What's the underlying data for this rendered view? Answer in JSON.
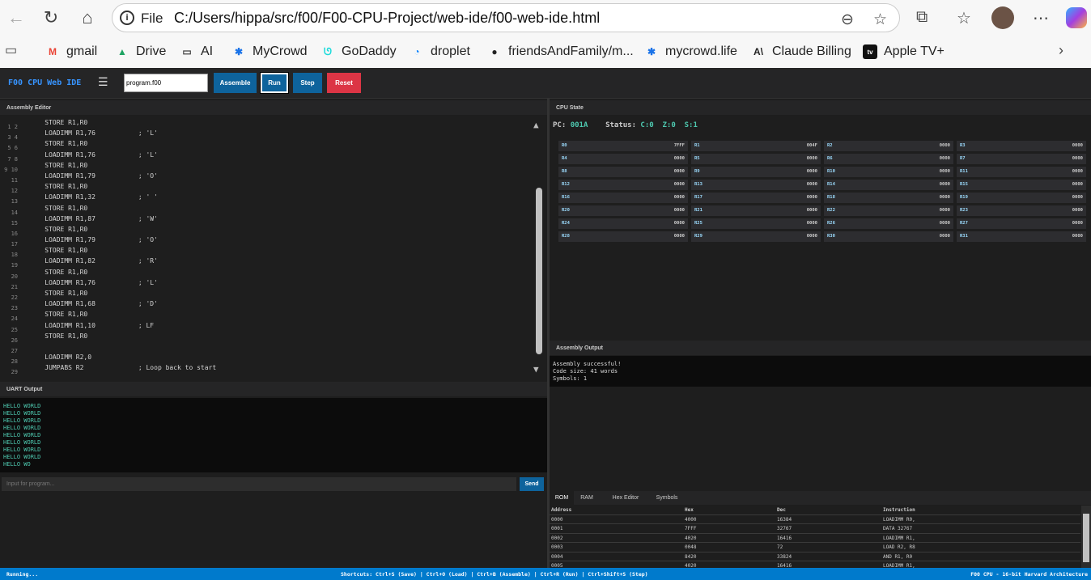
{
  "browser": {
    "file_label": "File",
    "url": "C:/Users/hippa/src/f00/F00-CPU-Project/web-ide/f00-web-ide.html",
    "bookmarks": [
      {
        "label": "gmail",
        "icon": "gmail-icon",
        "glyph": "M",
        "color": "#ea4335"
      },
      {
        "label": "Drive",
        "icon": "drive-icon",
        "glyph": "▲",
        "color": "#1fa463"
      },
      {
        "label": "AI",
        "icon": "folder-icon",
        "glyph": "▭",
        "color": "#444444"
      },
      {
        "label": "MyCrowd",
        "icon": "mycrowd-icon",
        "glyph": "✱",
        "color": "#1a73e8"
      },
      {
        "label": "GoDaddy",
        "icon": "godaddy-icon",
        "glyph": "ᘎ",
        "color": "#1bdbdb"
      },
      {
        "label": "droplet",
        "icon": "digitalocean-icon",
        "glyph": "◔",
        "color": "#0080ff"
      },
      {
        "label": "friendsAndFamily/m...",
        "icon": "github-icon",
        "glyph": "●",
        "color": "#222222"
      },
      {
        "label": "mycrowd.life",
        "icon": "mycrowd-icon",
        "glyph": "✱",
        "color": "#1a73e8"
      },
      {
        "label": "Claude Billing",
        "icon": "anthropic-icon",
        "glyph": "A\\",
        "color": "#222222"
      },
      {
        "label": "Apple TV+",
        "icon": "appletv-icon",
        "glyph": "tv",
        "color": "#111111"
      }
    ]
  },
  "toolbar": {
    "brand": "F00 CPU Web IDE",
    "menu_glyph": "☰",
    "filename": "program.f00",
    "assemble_label": "Assemble",
    "run_label": "Run",
    "step_label": "Step",
    "reset_label": "Reset",
    "colors": {
      "assemble": "#0e639c",
      "run": "#0e639c",
      "step": "#0e639c",
      "reset": "#dc3545"
    }
  },
  "editor": {
    "title": "Assembly Editor",
    "gutter": [
      "1 2",
      "3 4",
      "5 6",
      "7 8",
      "9 10",
      "11",
      "12",
      "13",
      "14",
      "15",
      "16",
      "17",
      "18",
      "19",
      "20",
      "21",
      "22",
      "23",
      "24",
      "25",
      "26",
      "27",
      "28",
      "29"
    ],
    "lines": [
      "    STORE R1,R0",
      "    LOADIMM R1,76           ; 'L'",
      "    STORE R1,R0",
      "    LOADIMM R1,76           ; 'L'",
      "    STORE R1,R0",
      "    LOADIMM R1,79           ; 'O'",
      "    STORE R1,R0",
      "    LOADIMM R1,32           ; ' '",
      "    STORE R1,R0",
      "    LOADIMM R1,87           ; 'W'",
      "    STORE R1,R0",
      "    LOADIMM R1,79           ; 'O'",
      "    STORE R1,R0",
      "    LOADIMM R1,82           ; 'R'",
      "    STORE R1,R0",
      "    LOADIMM R1,76           ; 'L'",
      "    STORE R1,R0",
      "    LOADIMM R1,68           ; 'D'",
      "    STORE R1,R0",
      "    LOADIMM R1,10           ; LF",
      "    STORE R1,R0",
      "",
      "    LOADIMM R2,0",
      "    JUMPABS R2              ; Loop back to start"
    ]
  },
  "uart": {
    "title": "UART Output",
    "lines": [
      "HELLO WORLD",
      "HELLO WORLD",
      "HELLO WORLD",
      "HELLO WORLD",
      "HELLO WORLD",
      "HELLO WORLD",
      "HELLO WORLD",
      "HELLO WORLD",
      "HELLO WO"
    ],
    "input_placeholder": "Input for program...",
    "send_label": "Send"
  },
  "cpu": {
    "title": "CPU State",
    "pc_label": "PC:",
    "pc_value": "001A",
    "status_label": "Status:",
    "flags": "C:0  Z:0  S:1",
    "registers": [
      {
        "name": "R0",
        "value": "7FFF"
      },
      {
        "name": "R1",
        "value": "004F"
      },
      {
        "name": "R2",
        "value": "0000"
      },
      {
        "name": "R3",
        "value": "0000"
      },
      {
        "name": "R4",
        "value": "0000"
      },
      {
        "name": "R5",
        "value": "0000"
      },
      {
        "name": "R6",
        "value": "0000"
      },
      {
        "name": "R7",
        "value": "0000"
      },
      {
        "name": "R8",
        "value": "0000"
      },
      {
        "name": "R9",
        "value": "0000"
      },
      {
        "name": "R10",
        "value": "0000"
      },
      {
        "name": "R11",
        "value": "0000"
      },
      {
        "name": "R12",
        "value": "0000"
      },
      {
        "name": "R13",
        "value": "0000"
      },
      {
        "name": "R14",
        "value": "0000"
      },
      {
        "name": "R15",
        "value": "0000"
      },
      {
        "name": "R16",
        "value": "0000"
      },
      {
        "name": "R17",
        "value": "0000"
      },
      {
        "name": "R18",
        "value": "0000"
      },
      {
        "name": "R19",
        "value": "0000"
      },
      {
        "name": "R20",
        "value": "0000"
      },
      {
        "name": "R21",
        "value": "0000"
      },
      {
        "name": "R22",
        "value": "0000"
      },
      {
        "name": "R23",
        "value": "0000"
      },
      {
        "name": "R24",
        "value": "0000"
      },
      {
        "name": "R25",
        "value": "0000"
      },
      {
        "name": "R26",
        "value": "0000"
      },
      {
        "name": "R27",
        "value": "0000"
      },
      {
        "name": "R28",
        "value": "0000"
      },
      {
        "name": "R29",
        "value": "0000"
      },
      {
        "name": "R30",
        "value": "0000"
      },
      {
        "name": "R31",
        "value": "0000"
      }
    ]
  },
  "assembly_output": {
    "title": "Assembly Output",
    "lines": [
      "Assembly successful!",
      "Code size: 41 words",
      "Symbols: 1"
    ]
  },
  "memory": {
    "tabs": [
      "ROM",
      "RAM",
      "Hex Editor",
      "Symbols"
    ],
    "active_tab": "ROM",
    "columns": [
      "Address",
      "Hex",
      "Dec",
      "Instruction"
    ],
    "rows": [
      [
        "0000",
        "4000",
        "16384",
        "LOADIMM R0,"
      ],
      [
        "0001",
        "7FFF",
        "32767",
        "DATA 32767"
      ],
      [
        "0002",
        "4020",
        "16416",
        "LOADIMM R1,"
      ],
      [
        "0003",
        "0048",
        "72",
        "LOAD R2, R8"
      ],
      [
        "0004",
        "8420",
        "33824",
        "AND R1, R0"
      ],
      [
        "0005",
        "4020",
        "16416",
        "LOADIMM R1,"
      ]
    ]
  },
  "statusbar": {
    "left": "Running...",
    "center": "Shortcuts: Ctrl+S (Save) | Ctrl+O (Load) | Ctrl+B (Assemble) | Ctrl+R (Run) | Ctrl+Shift+S (Step)",
    "right": "F00 CPU - 16-bit Harvard Architecture"
  }
}
